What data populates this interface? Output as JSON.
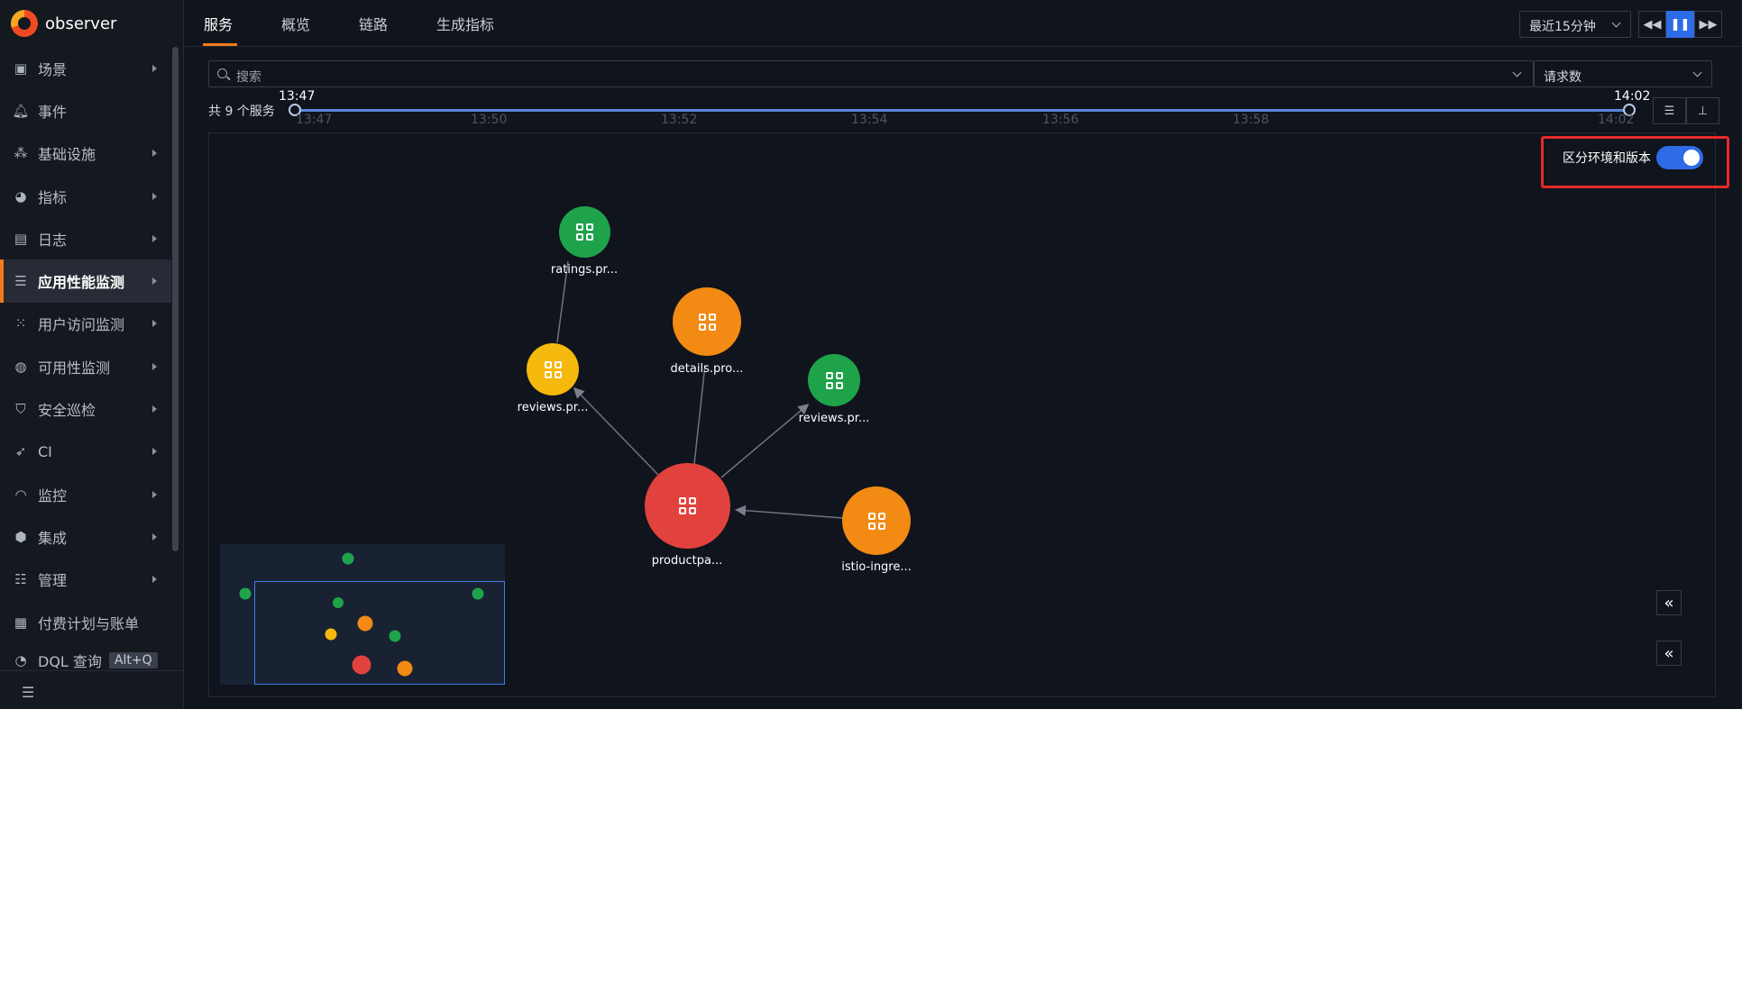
{
  "brand": {
    "name": "observer",
    "colors": {
      "orange": "#ef4a23",
      "yellow": "#f6a623"
    }
  },
  "sidebar": {
    "items": [
      {
        "label": "场景",
        "icon": "dashboard-icon",
        "arrow": true,
        "active": false
      },
      {
        "label": "事件",
        "icon": "bell-icon",
        "arrow": false,
        "active": false
      },
      {
        "label": "基础设施",
        "icon": "cluster-icon",
        "arrow": true,
        "active": false
      },
      {
        "label": "指标",
        "icon": "metrics-icon",
        "arrow": true,
        "active": false
      },
      {
        "label": "日志",
        "icon": "calendar-icon",
        "arrow": true,
        "active": false
      },
      {
        "label": "应用性能监测",
        "icon": "apm-icon",
        "arrow": true,
        "active": true
      },
      {
        "label": "用户访问监测",
        "icon": "rum-icon",
        "arrow": true,
        "active": false
      },
      {
        "label": "可用性监测",
        "icon": "globe-icon",
        "arrow": true,
        "active": false
      },
      {
        "label": "安全巡检",
        "icon": "shield-icon",
        "arrow": true,
        "active": false
      },
      {
        "label": "CI",
        "icon": "rocket-icon",
        "arrow": true,
        "active": false
      },
      {
        "label": "监控",
        "icon": "monitor-icon",
        "arrow": true,
        "active": false
      },
      {
        "label": "集成",
        "icon": "cube-icon",
        "arrow": true,
        "active": false
      },
      {
        "label": "管理",
        "icon": "sliders-icon",
        "arrow": true,
        "active": false
      },
      {
        "label": "付费计划与账单",
        "icon": "billing-icon",
        "arrow": false,
        "active": false
      },
      {
        "label": "DQL 查询",
        "icon": "query-icon",
        "arrow": false,
        "active": false,
        "shortcut": "Alt+Q"
      }
    ]
  },
  "tabs": [
    {
      "label": "服务",
      "active": true
    },
    {
      "label": "概览",
      "active": false
    },
    {
      "label": "链路",
      "active": false
    },
    {
      "label": "生成指标",
      "active": false
    }
  ],
  "toolbar": {
    "time_range": "最近15分钟",
    "rewind_icon": "rewind-icon",
    "pause_icon": "pause-icon",
    "forward_icon": "fast-forward-icon"
  },
  "search": {
    "placeholder": "搜索"
  },
  "metric": {
    "selected": "请求数"
  },
  "timeline": {
    "service_count": "共 9 个服务",
    "start": "13:47",
    "end": "14:02",
    "ticks": [
      "13:47",
      "13:50",
      "13:52",
      "13:54",
      "13:56",
      "13:58",
      "14:02"
    ]
  },
  "toggle": {
    "label": "区分环境和版本",
    "on": true
  },
  "graph": {
    "node_colors": {
      "green": "#1fa34a",
      "yellow": "#f5b80c",
      "orange": "#f28a14",
      "red": "#e2423d"
    },
    "nodes": [
      {
        "label": "ratings.pr...",
        "color": "green"
      },
      {
        "label": "details.pro...",
        "color": "orange"
      },
      {
        "label": "reviews.pr...",
        "color": "yellow"
      },
      {
        "label": "reviews.pr...",
        "color": "green"
      },
      {
        "label": "productpa...",
        "color": "red"
      },
      {
        "label": "istio-ingre...",
        "color": "orange"
      }
    ]
  }
}
